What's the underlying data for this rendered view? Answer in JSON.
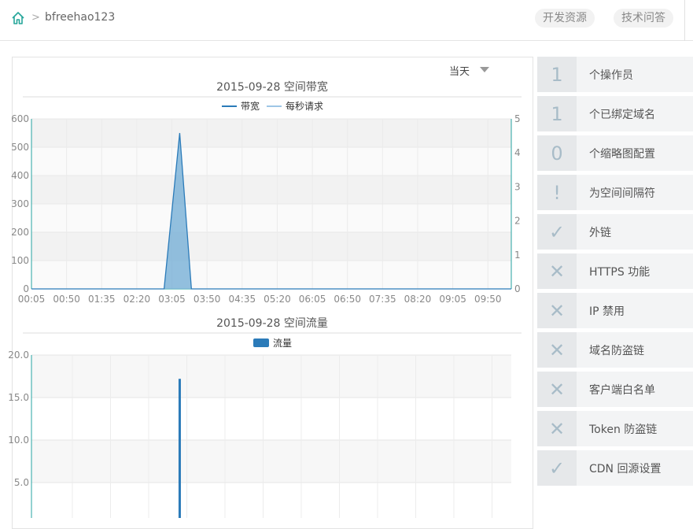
{
  "header": {
    "user": "bfreehao123",
    "separator": ">",
    "links": [
      "开发资源",
      "技术问答"
    ]
  },
  "range_select": {
    "value": "当天"
  },
  "sidebar": {
    "items": [
      {
        "icon": "1",
        "icon_name": "count",
        "label": "个操作员"
      },
      {
        "icon": "1",
        "icon_name": "count",
        "label": "个已绑定域名"
      },
      {
        "icon": "0",
        "icon_name": "count",
        "label": "个缩略图配置"
      },
      {
        "icon": "!",
        "icon_name": "exclamation-icon",
        "label": "为空间间隔符"
      },
      {
        "icon": "✓",
        "icon_name": "check-icon",
        "label": "外链"
      },
      {
        "icon": "✕",
        "icon_name": "close-icon",
        "label": "HTTPS 功能"
      },
      {
        "icon": "✕",
        "icon_name": "close-icon",
        "label": "IP 禁用"
      },
      {
        "icon": "✕",
        "icon_name": "close-icon",
        "label": "域名防盗链"
      },
      {
        "icon": "✕",
        "icon_name": "close-icon",
        "label": "客户端白名单"
      },
      {
        "icon": "✕",
        "icon_name": "close-icon",
        "label": "Token 防盗链"
      },
      {
        "icon": "✓",
        "icon_name": "check-icon",
        "label": "CDN 回源设置"
      }
    ]
  },
  "colors": {
    "bandwidth": "#2b7bb9",
    "requests": "#9ec6e6",
    "flow": "#2b7bb9",
    "teal": "#24a3a0"
  },
  "chart_data": [
    {
      "type": "area",
      "title": "2015-09-28 空间带宽",
      "legend": [
        "带宽",
        "每秒请求"
      ],
      "x_ticks": [
        "00:05",
        "00:50",
        "01:35",
        "02:20",
        "03:05",
        "03:50",
        "04:35",
        "05:20",
        "06:05",
        "06:50",
        "07:35",
        "08:20",
        "09:05",
        "09:50"
      ],
      "y_left": {
        "ticks": [
          0,
          100,
          200,
          300,
          400,
          500,
          600
        ],
        "lim": [
          0,
          600
        ]
      },
      "y_right": {
        "ticks": [
          0,
          1,
          2,
          3,
          4,
          5
        ],
        "lim": [
          0,
          5
        ]
      },
      "series": [
        {
          "name": "带宽",
          "points": [
            [
              "00:05",
              0
            ],
            [
              "02:55",
              0
            ],
            [
              "03:15",
              550
            ],
            [
              "03:30",
              0
            ],
            [
              "10:20",
              0
            ]
          ]
        },
        {
          "name": "每秒请求",
          "points": [
            [
              "00:05",
              0
            ],
            [
              "10:20",
              0
            ]
          ]
        }
      ]
    },
    {
      "type": "bar",
      "title": "2015-09-28 空间流量",
      "legend": [
        "流量"
      ],
      "y": {
        "ticks": [
          "5.0",
          "10.0",
          "15.0",
          "20.0"
        ],
        "lim": [
          0,
          20
        ]
      },
      "series": [
        {
          "name": "流量",
          "points": [
            [
              "03:15",
              17.2
            ]
          ]
        }
      ]
    }
  ]
}
